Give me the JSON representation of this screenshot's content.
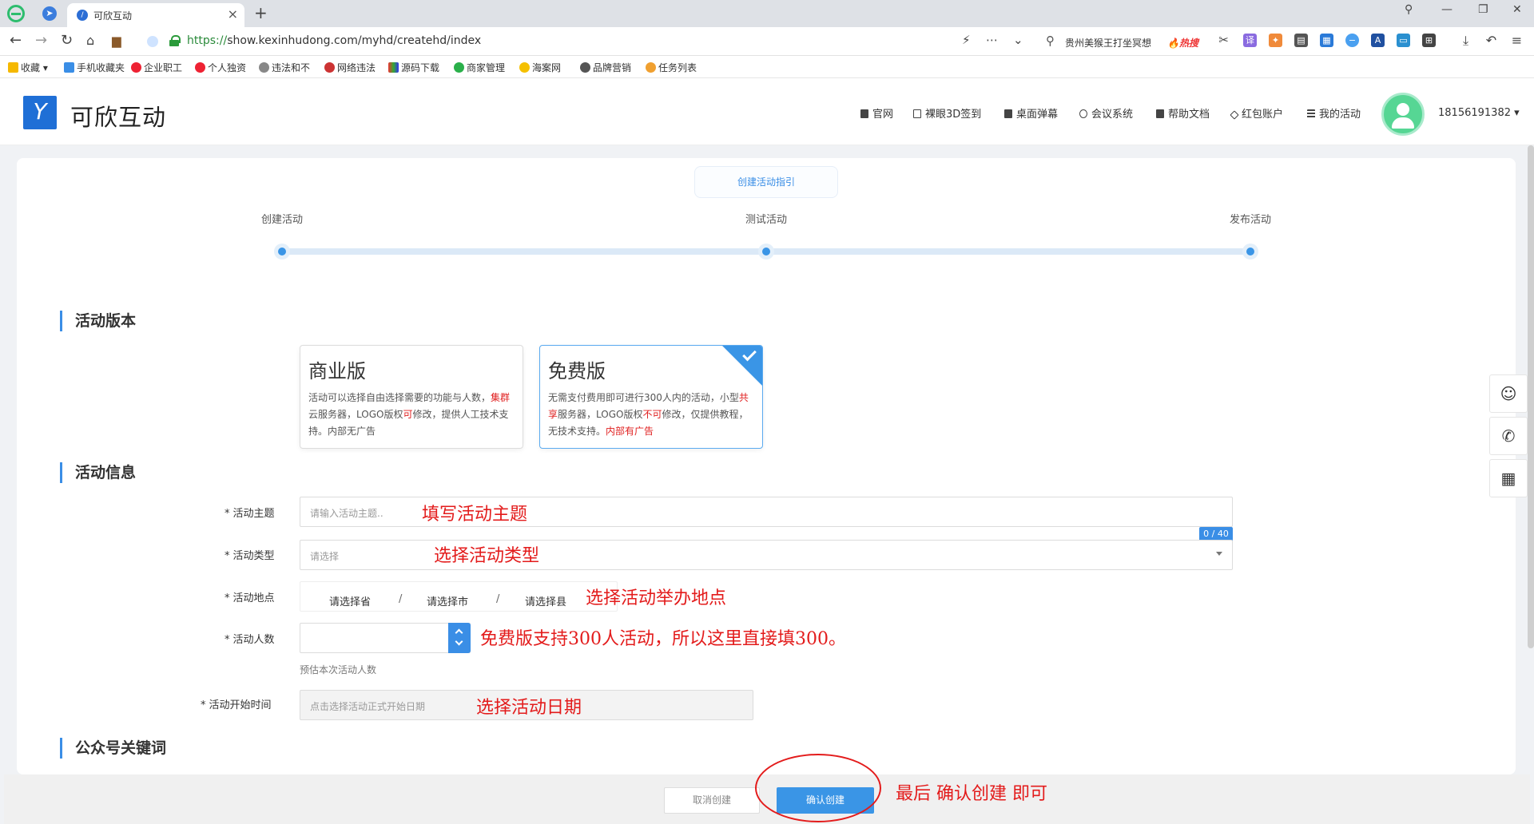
{
  "browser": {
    "tab_title": "可欣互动",
    "tab_close": "×",
    "new_tab": "+",
    "url_scheme": "https://",
    "url_rest": "show.kexinhudong.com/myhd/createhd/index",
    "search_query": "贵州美猴王打坐冥想",
    "search_tag": "🔥热搜",
    "bookmarks": [
      "收藏",
      "手机收藏夹",
      "企业职工",
      "个人独资",
      "违法和不",
      "网络违法",
      "源码下载",
      "商家管理",
      "海案网",
      "品牌营销",
      "任务列表"
    ]
  },
  "header": {
    "logo_glyph": "Y",
    "logo_text": "可欣互动",
    "nav": [
      "官网",
      "裸眼3D签到",
      "桌面弹幕",
      "会议系统",
      "帮助文档",
      "红包账户",
      "我的活动"
    ],
    "user_phone": "18156191382 ▾"
  },
  "guide_button": "创建活动指引",
  "steps": [
    "创建活动",
    "测试活动",
    "发布活动"
  ],
  "section_version": "活动版本",
  "versions": [
    {
      "title": "商业版",
      "desc_parts": [
        "活动可以选择自由选择需要的功能与人数，",
        "集群",
        "云服务器，LOGO版权",
        "可",
        "修改，提供人工技术支持。内部无广告"
      ]
    },
    {
      "title": "免费版",
      "desc_parts": [
        "无需支付费用即可进行300人内的活动，小型",
        "共享",
        "服务器，LOGO版权",
        "不可",
        "修改，仅提供教程，无技术支持。",
        "内部有广告"
      ]
    }
  ],
  "section_info": "活动信息",
  "form": {
    "topic_label": "活动主题",
    "topic_placeholder": "请输入活动主题..",
    "topic_counter": "0 / 40",
    "type_label": "活动类型",
    "type_placeholder": "请选择",
    "location_label": "活动地点",
    "province": "请选择省",
    "city": "请选择市",
    "county": "请选择县",
    "sep": "/",
    "people_label": "活动人数",
    "people_hint": "预估本次活动人数",
    "start_label": "活动开始时间",
    "start_placeholder": "点击选择活动正式开始日期",
    "required_mark": "*"
  },
  "section_keyword": "公众号关键词",
  "annotations": {
    "topic": "填写活动主题",
    "type": "选择活动类型",
    "location": "选择活动举办地点",
    "people": "免费版支持300人活动，所以这里直接填300。",
    "date": "选择活动日期",
    "final": "最后 确认创建 即可"
  },
  "actions": {
    "cancel": "取消创建",
    "confirm": "确认创建"
  },
  "colors": {
    "primary": "#3a8ee6",
    "annotation_red": "#e31b1b",
    "logo_blue": "#1f6fd6",
    "avatar_green": "#56d694"
  }
}
